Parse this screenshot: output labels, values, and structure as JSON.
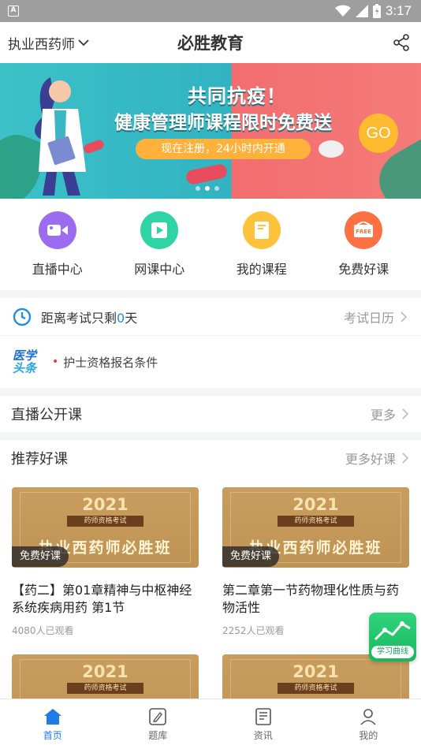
{
  "status_bar": {
    "time": "3:17",
    "notification_icon": "A"
  },
  "header": {
    "exam_select": "执业西药师",
    "title": "必胜教育"
  },
  "banner": {
    "line1": "共同抗疫！",
    "line2": "健康管理师课程限时免费送",
    "sub": "现在注册，24小时内开通",
    "go": "GO",
    "dot_count": 3,
    "active_dot": 1
  },
  "quick_menu": [
    {
      "label": "直播中心",
      "icon": "video-camera-icon",
      "color": "#9b6cf0"
    },
    {
      "label": "网课中心",
      "icon": "play-icon",
      "color": "#2fd4a6"
    },
    {
      "label": "我的课程",
      "icon": "book-icon",
      "color": "#ffc23d"
    },
    {
      "label": "免费好课",
      "icon": "free-tag-icon",
      "color": "#ff7043"
    }
  ],
  "countdown": {
    "prefix": "距离考试只剩",
    "days": "0",
    "suffix": "天",
    "link": "考试日历"
  },
  "news": {
    "logo_line1": "医学",
    "logo_line2": "头条",
    "headline": "护士资格报名条件"
  },
  "live_section": {
    "title": "直播公开课",
    "more": "更多"
  },
  "recommend_section": {
    "title": "推荐好课",
    "more": "更多好课"
  },
  "courses": [
    {
      "year": "2021",
      "ribbon": "药师资格考试",
      "banner": "执业西药师必胜班",
      "badge": "免费好课",
      "title": "【药二】第01章精神与中枢神经系统疾病用药 第1节",
      "views": "4080人已观看"
    },
    {
      "year": "2021",
      "ribbon": "药师资格考试",
      "banner": "执业西药师必胜班",
      "badge": "免费好课",
      "title": "第二章第一节药物理化性质与药物活性",
      "views": "2252人已观看"
    }
  ],
  "floating_widget": {
    "label": "学习曲线"
  },
  "bottom_nav": [
    {
      "label": "首页",
      "icon": "home-icon",
      "active": true
    },
    {
      "label": "题库",
      "icon": "question-bank-icon",
      "active": false
    },
    {
      "label": "资讯",
      "icon": "news-icon",
      "active": false
    },
    {
      "label": "我的",
      "icon": "profile-icon",
      "active": false
    }
  ],
  "colors": {
    "accent": "#1f7be5",
    "countdown_number": "#1f8fe6"
  }
}
